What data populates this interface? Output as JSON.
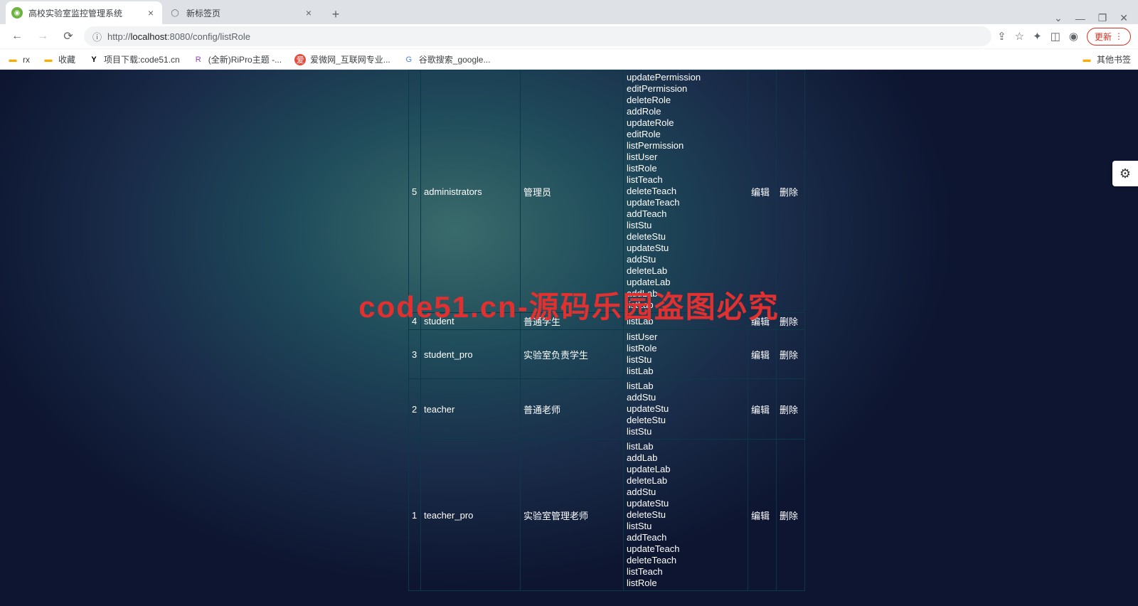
{
  "browser": {
    "tabs": [
      {
        "title": "高校实验室监控管理系统",
        "active": true
      },
      {
        "title": "新标签页",
        "active": false
      }
    ],
    "url_host": "localhost",
    "url_port": ":8080",
    "url_path": "/config/listRole",
    "url_prefix": "http://",
    "update_label": "更新",
    "bookmarks": [
      {
        "label": "rx",
        "icon_color": "#f9ab00"
      },
      {
        "label": "收藏",
        "icon_color": "#f9ab00"
      },
      {
        "label": "项目下载:code51.cn",
        "icon_color": "#000"
      },
      {
        "label": "(全新)RiPro主题 -...",
        "icon_color": "#8e44ad"
      },
      {
        "label": "爱微网_互联网专业...",
        "icon_color": "#e74c3c"
      },
      {
        "label": "谷歌搜索_google...",
        "icon_color": "#4285f4"
      }
    ],
    "other_bookmarks": "其他书签"
  },
  "watermark_text": "code51.cn-源码乐园盗图必究",
  "actions": {
    "edit": "编辑",
    "delete": "删除"
  },
  "roles": [
    {
      "id": "5",
      "name": "administrators",
      "desc": "管理员",
      "perms": [
        "updatePermission",
        "editPermission",
        "deleteRole",
        "addRole",
        "updateRole",
        "editRole",
        "listPermission",
        "listUser",
        "listRole",
        "listTeach",
        "deleteTeach",
        "updateTeach",
        "addTeach",
        "listStu",
        "deleteStu",
        "updateStu",
        "addStu",
        "deleteLab",
        "updateLab",
        "addLab",
        "listLab"
      ]
    },
    {
      "id": "4",
      "name": "student",
      "desc": "普通学生",
      "perms": [
        "listLab"
      ]
    },
    {
      "id": "3",
      "name": "student_pro",
      "desc": "实验室负责学生",
      "perms": [
        "listUser",
        "listRole",
        "listStu",
        "listLab"
      ]
    },
    {
      "id": "2",
      "name": "teacher",
      "desc": "普通老师",
      "perms": [
        "listLab",
        "addStu",
        "updateStu",
        "deleteStu",
        "listStu"
      ]
    },
    {
      "id": "1",
      "name": "teacher_pro",
      "desc": "实验室管理老师",
      "perms": [
        "listLab",
        "addLab",
        "updateLab",
        "deleteLab",
        "addStu",
        "updateStu",
        "deleteStu",
        "listStu",
        "addTeach",
        "updateTeach",
        "deleteTeach",
        "listTeach",
        "listRole"
      ]
    }
  ]
}
